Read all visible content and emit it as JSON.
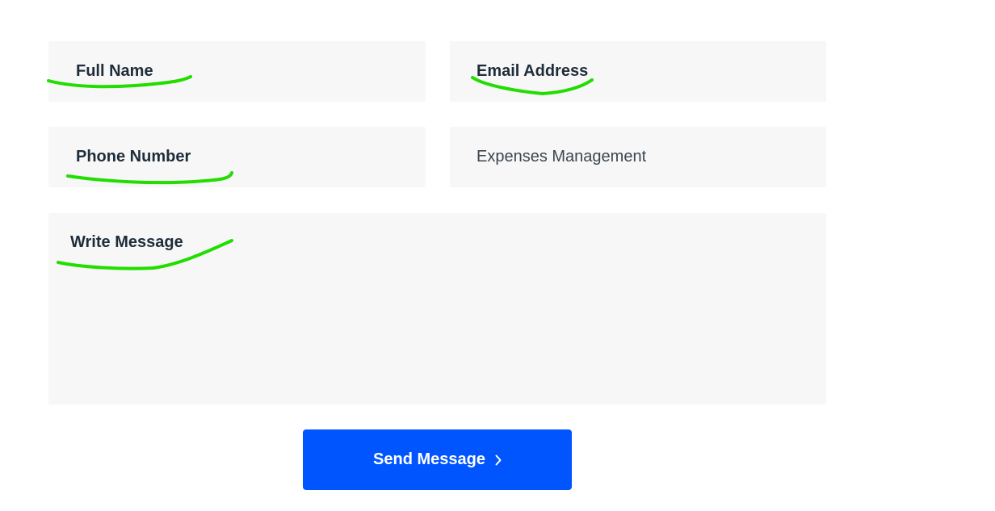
{
  "form": {
    "full_name_placeholder": "Full Name",
    "email_placeholder": "Email Address",
    "phone_placeholder": "Phone Number",
    "subject_value": "Expenses Management",
    "message_placeholder": "Write Message"
  },
  "send_button": {
    "label": "Send Message",
    "icon": "chevron-right-icon"
  },
  "colors": {
    "field_background": "#f7f7f7",
    "button_background": "#0055ff",
    "button_text": "#ffffff",
    "text": "#1f2d3a",
    "annotation": "#22dd00"
  }
}
